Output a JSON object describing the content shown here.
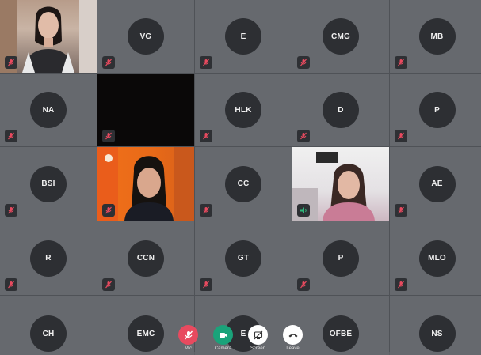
{
  "participants": [
    {
      "type": "video",
      "name": "",
      "muted": true
    },
    {
      "type": "initials",
      "initials": "VG",
      "muted": true
    },
    {
      "type": "initials",
      "initials": "E",
      "muted": true
    },
    {
      "type": "initials",
      "initials": "CMG",
      "muted": true
    },
    {
      "type": "initials",
      "initials": "MB",
      "muted": true
    },
    {
      "type": "initials",
      "initials": "NA",
      "muted": true
    },
    {
      "type": "video-off",
      "name": "",
      "muted": true
    },
    {
      "type": "initials",
      "initials": "HLK",
      "muted": true
    },
    {
      "type": "initials",
      "initials": "D",
      "muted": true
    },
    {
      "type": "initials",
      "initials": "P",
      "muted": true
    },
    {
      "type": "initials",
      "initials": "BSI",
      "muted": true
    },
    {
      "type": "video",
      "name": "",
      "muted": true
    },
    {
      "type": "initials",
      "initials": "CC",
      "muted": true
    },
    {
      "type": "video",
      "name": "",
      "muted": false
    },
    {
      "type": "initials",
      "initials": "AE",
      "muted": true
    },
    {
      "type": "initials",
      "initials": "R",
      "muted": true
    },
    {
      "type": "initials",
      "initials": "CCN",
      "muted": true
    },
    {
      "type": "initials",
      "initials": "GT",
      "muted": true
    },
    {
      "type": "initials",
      "initials": "P",
      "muted": true
    },
    {
      "type": "initials",
      "initials": "MLO",
      "muted": true
    },
    {
      "type": "initials",
      "initials": "CH",
      "muted": true
    },
    {
      "type": "initials",
      "initials": "EMC",
      "muted": true
    },
    {
      "type": "initials",
      "initials": "E",
      "muted": true
    },
    {
      "type": "initials",
      "initials": "OFBE",
      "muted": true
    },
    {
      "type": "initials",
      "initials": "NS",
      "muted": true
    }
  ],
  "controls": {
    "mic": {
      "label": "Mic",
      "icon": "mic-off-icon",
      "color": "#e84a5f"
    },
    "camera": {
      "label": "Camera",
      "icon": "camera-icon",
      "color": "#1aa37a"
    },
    "screen": {
      "label": "Screen",
      "icon": "screen-share-off-icon",
      "color": "#ffffff"
    },
    "leave": {
      "label": "Leave",
      "icon": "phone-hangup-icon",
      "color": "#ffffff"
    }
  },
  "colors": {
    "muted_icon": "#e84a5f",
    "speaking_icon": "#2fb67a"
  }
}
